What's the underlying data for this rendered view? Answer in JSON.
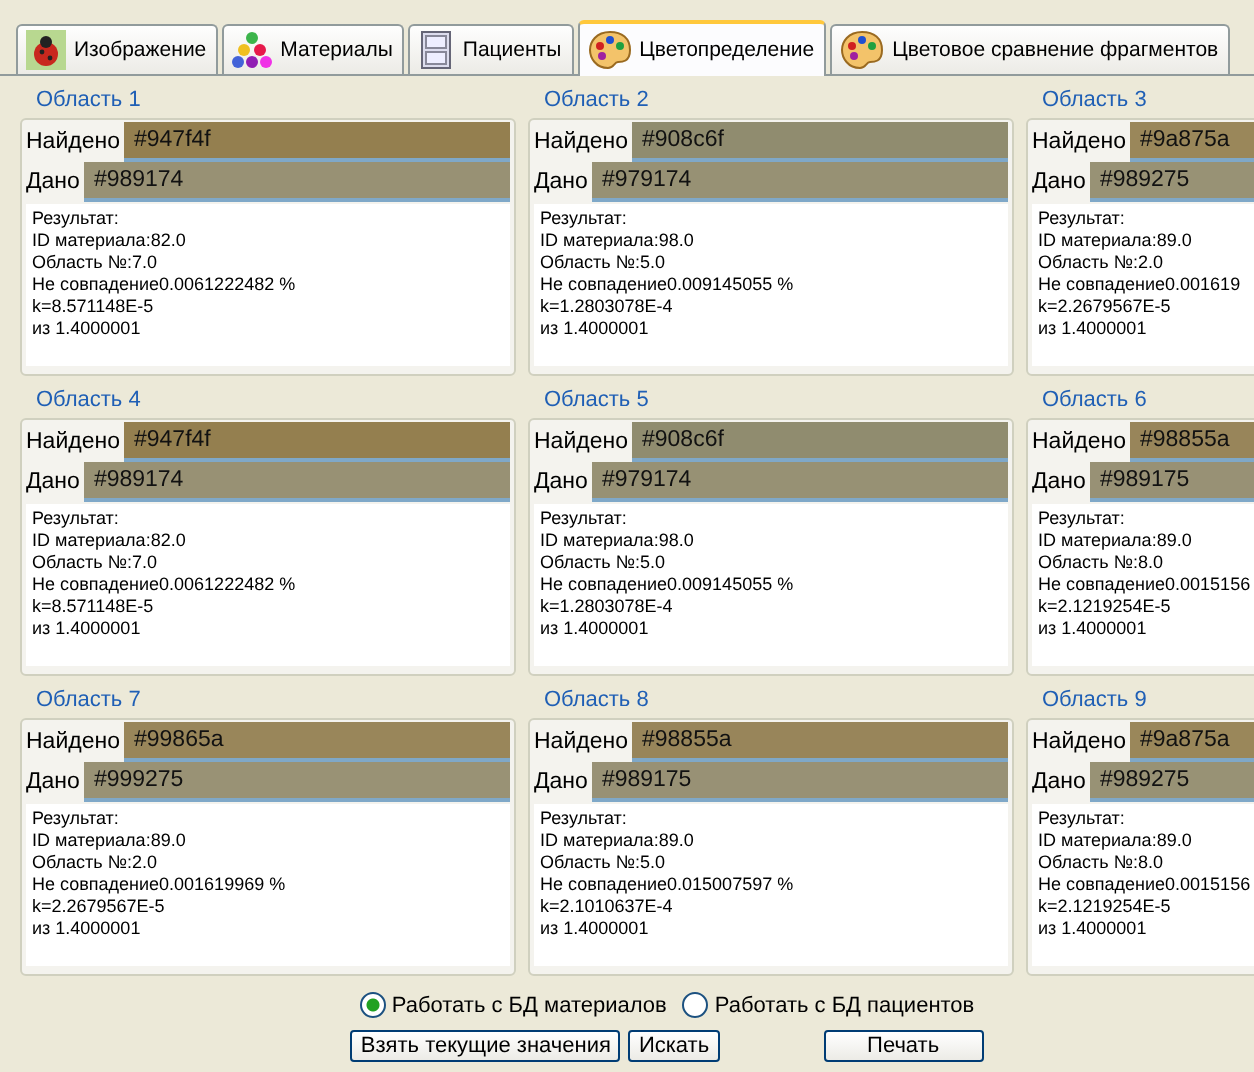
{
  "tabs": [
    {
      "label": "Изображение",
      "selected": false
    },
    {
      "label": "Материалы",
      "selected": false
    },
    {
      "label": "Пациенты",
      "selected": false
    },
    {
      "label": "Цветопределение",
      "selected": true
    },
    {
      "label": "Цветовое сравнение фрагментов",
      "selected": false
    }
  ],
  "areas": [
    {
      "title": "Область 1",
      "found": {
        "label": "Найдено",
        "value": "#947f4f",
        "color": "#947f4f"
      },
      "given": {
        "label": "Дано",
        "value": "#989174",
        "color": "#989174"
      },
      "result": [
        "Результат:",
        "ID материала:82.0",
        "Область №:7.0",
        "Не совпадение0.0061222482 %",
        "k=8.571148E-5",
        "из 1.4000001"
      ]
    },
    {
      "title": "Область 2",
      "found": {
        "label": "Найдено",
        "value": "#908c6f",
        "color": "#908c6f"
      },
      "given": {
        "label": "Дано",
        "value": "#979174",
        "color": "#979174"
      },
      "result": [
        "Результат:",
        "ID материала:98.0",
        "Область №:5.0",
        "Не совпадение0.009145055 %",
        "k=1.2803078E-4",
        "из 1.4000001"
      ]
    },
    {
      "title": "Область 3",
      "found": {
        "label": "Найдено",
        "value": "#9a875a",
        "color": "#9a875a"
      },
      "given": {
        "label": "Дано",
        "value": "#989275",
        "color": "#989275"
      },
      "result": [
        "Результат:",
        "ID материала:89.0",
        "Область №:2.0",
        "Не совпадение0.001619",
        "k=2.2679567E-5",
        "из 1.4000001"
      ]
    },
    {
      "title": "Область 4",
      "found": {
        "label": "Найдено",
        "value": "#947f4f",
        "color": "#947f4f"
      },
      "given": {
        "label": "Дано",
        "value": "#989174",
        "color": "#989174"
      },
      "result": [
        "Результат:",
        "ID материала:82.0",
        "Область №:7.0",
        "Не совпадение0.0061222482 %",
        "k=8.571148E-5",
        "из 1.4000001"
      ]
    },
    {
      "title": "Область 5",
      "found": {
        "label": "Найдено",
        "value": "#908c6f",
        "color": "#908c6f"
      },
      "given": {
        "label": "Дано",
        "value": "#979174",
        "color": "#979174"
      },
      "result": [
        "Результат:",
        "ID материала:98.0",
        "Область №:5.0",
        "Не совпадение0.009145055 %",
        "k=1.2803078E-4",
        "из 1.4000001"
      ]
    },
    {
      "title": "Область 6",
      "found": {
        "label": "Найдено",
        "value": "#98855a",
        "color": "#98855a"
      },
      "given": {
        "label": "Дано",
        "value": "#989175",
        "color": "#989175"
      },
      "result": [
        "Результат:",
        "ID материала:89.0",
        "Область №:8.0",
        "Не совпадение0.0015156",
        "k=2.1219254E-5",
        "из 1.4000001"
      ]
    },
    {
      "title": "Область 7",
      "found": {
        "label": "Найдено",
        "value": "#99865a",
        "color": "#99865a"
      },
      "given": {
        "label": "Дано",
        "value": "#999275",
        "color": "#999275"
      },
      "result": [
        "Результат:",
        "ID материала:89.0",
        "Область №:2.0",
        "Не совпадение0.001619969 %",
        "k=2.2679567E-5",
        "из 1.4000001"
      ]
    },
    {
      "title": "Область 8",
      "found": {
        "label": "Найдено",
        "value": "#98855a",
        "color": "#98855a"
      },
      "given": {
        "label": "Дано",
        "value": "#989175",
        "color": "#989175"
      },
      "result": [
        "Результат:",
        "ID материала:89.0",
        "Область №:5.0",
        "Не совпадение0.015007597 %",
        "k=2.1010637E-4",
        "из 1.4000001"
      ]
    },
    {
      "title": "Область 9",
      "found": {
        "label": "Найдено",
        "value": "#9a875a",
        "color": "#9a875a"
      },
      "given": {
        "label": "Дано",
        "value": "#989275",
        "color": "#989275"
      },
      "result": [
        "Результат:",
        "ID материала:89.0",
        "Область №:8.0",
        "Не совпадение0.0015156",
        "k=2.1219254E-5",
        "из 1.4000001"
      ]
    }
  ],
  "database": [
    {
      "label": "Работать с БД материалов",
      "selected": true
    },
    {
      "label": "Работать с БД пациентов",
      "selected": false
    }
  ],
  "buttons": [
    "Взять текущие значения",
    "Искать",
    "Печать"
  ]
}
